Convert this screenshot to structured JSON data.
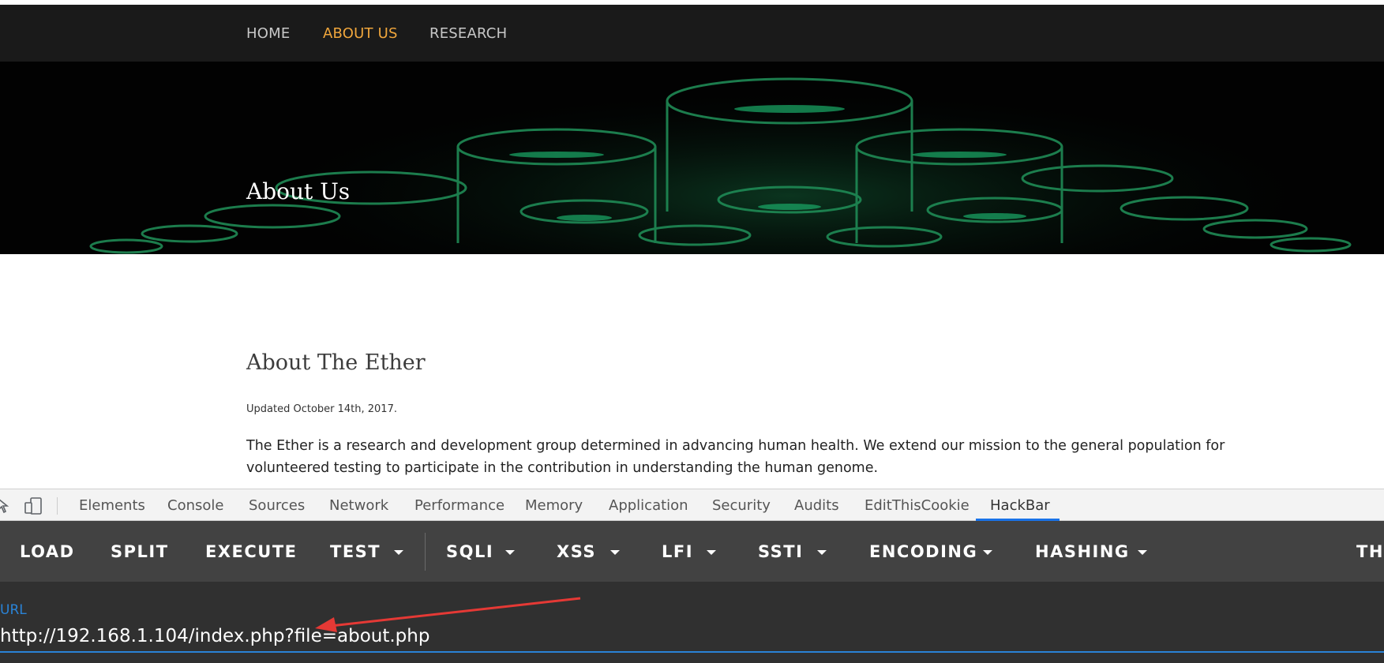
{
  "nav": {
    "items": [
      {
        "label": "HOME",
        "active": false
      },
      {
        "label": "ABOUT US",
        "active": true
      },
      {
        "label": "RESEARCH",
        "active": false
      }
    ],
    "active_color": "#f0a63c"
  },
  "hero": {
    "title": "About Us"
  },
  "content": {
    "title": "About The Ether",
    "updated": "Updated October 14th, 2017.",
    "paragraph": "The Ether is a research and development group determined in advancing human health. We extend our mission to the general population for volunteered testing to participate in the contribution in understanding the human genome."
  },
  "devtools": {
    "tabs": [
      "Elements",
      "Console",
      "Sources",
      "Network",
      "Performance",
      "Memory",
      "Application",
      "Security",
      "Audits",
      "EditThisCookie",
      "HackBar"
    ],
    "active_tab": "HackBar"
  },
  "hackbar": {
    "buttons": [
      "LOAD",
      "SPLIT",
      "EXECUTE",
      "TEST",
      "SQLI",
      "XSS",
      "LFI",
      "SSTI",
      "ENCODING",
      "HASHING",
      "THE"
    ],
    "url_label": "URL",
    "url_value": "http://192.168.1.104/index.php?file=about.php"
  },
  "colors": {
    "accent": "#2a83d6",
    "annotation_arrow": "#e53935"
  }
}
